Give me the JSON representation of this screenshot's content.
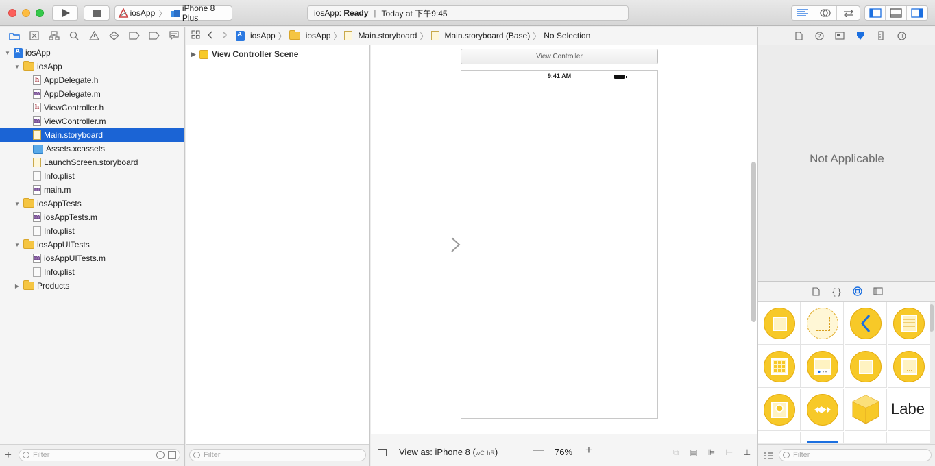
{
  "toolbar": {
    "scheme_name": "iosApp",
    "device_name": "iPhone 8 Plus",
    "activity_app": "iosApp:",
    "activity_status": "Ready",
    "activity_time": "Today at 下午9:45"
  },
  "navigator": {
    "tabs": [
      "project-navigator",
      "source-control-navigator",
      "symbol-navigator",
      "find-navigator",
      "issue-navigator",
      "test-navigator",
      "debug-navigator",
      "breakpoint-navigator",
      "report-navigator"
    ],
    "tree": [
      {
        "label": "iosApp",
        "type": "project",
        "indent": 0,
        "expanded": true
      },
      {
        "label": "iosApp",
        "type": "folder",
        "indent": 1,
        "expanded": true
      },
      {
        "label": "AppDelegate.h",
        "type": "h",
        "indent": 2
      },
      {
        "label": "AppDelegate.m",
        "type": "m",
        "indent": 2
      },
      {
        "label": "ViewController.h",
        "type": "h",
        "indent": 2
      },
      {
        "label": "ViewController.m",
        "type": "m",
        "indent": 2
      },
      {
        "label": "Main.storyboard",
        "type": "storyboard",
        "indent": 2,
        "selected": true
      },
      {
        "label": "Assets.xcassets",
        "type": "xcassets",
        "indent": 2
      },
      {
        "label": "LaunchScreen.storyboard",
        "type": "storyboard",
        "indent": 2
      },
      {
        "label": "Info.plist",
        "type": "plist",
        "indent": 2
      },
      {
        "label": "main.m",
        "type": "m",
        "indent": 2
      },
      {
        "label": "iosAppTests",
        "type": "folder",
        "indent": 1,
        "expanded": true
      },
      {
        "label": "iosAppTests.m",
        "type": "m",
        "indent": 2
      },
      {
        "label": "Info.plist",
        "type": "plist",
        "indent": 2
      },
      {
        "label": "iosAppUITests",
        "type": "folder",
        "indent": 1,
        "expanded": true
      },
      {
        "label": "iosAppUITests.m",
        "type": "m",
        "indent": 2
      },
      {
        "label": "Info.plist",
        "type": "plist",
        "indent": 2
      },
      {
        "label": "Products",
        "type": "folder",
        "indent": 1,
        "expanded": false
      }
    ],
    "filter_placeholder": "Filter"
  },
  "jump_bar": {
    "items": [
      "iosApp",
      "iosApp",
      "Main.storyboard",
      "Main.storyboard (Base)",
      "No Selection"
    ]
  },
  "outline": {
    "scene": "View Controller Scene",
    "filter_placeholder": "Filter"
  },
  "canvas": {
    "scene_title": "View Controller",
    "status_time": "9:41 AM",
    "view_as_label": "View as: iPhone 8 (",
    "view_as_w": "wC",
    "view_as_h": "hR",
    "view_as_close": ")",
    "zoom_minus": "—",
    "zoom_value": "76%",
    "zoom_plus": "+"
  },
  "inspector": {
    "message": "Not Applicable",
    "lib_label_text": "Labe",
    "filter_placeholder": "Filter"
  },
  "colors": {
    "selection": "#1b64d5",
    "folder": "#f5c542",
    "library_yellow": "#f7c928",
    "accent_blue": "#1b6fe0"
  }
}
